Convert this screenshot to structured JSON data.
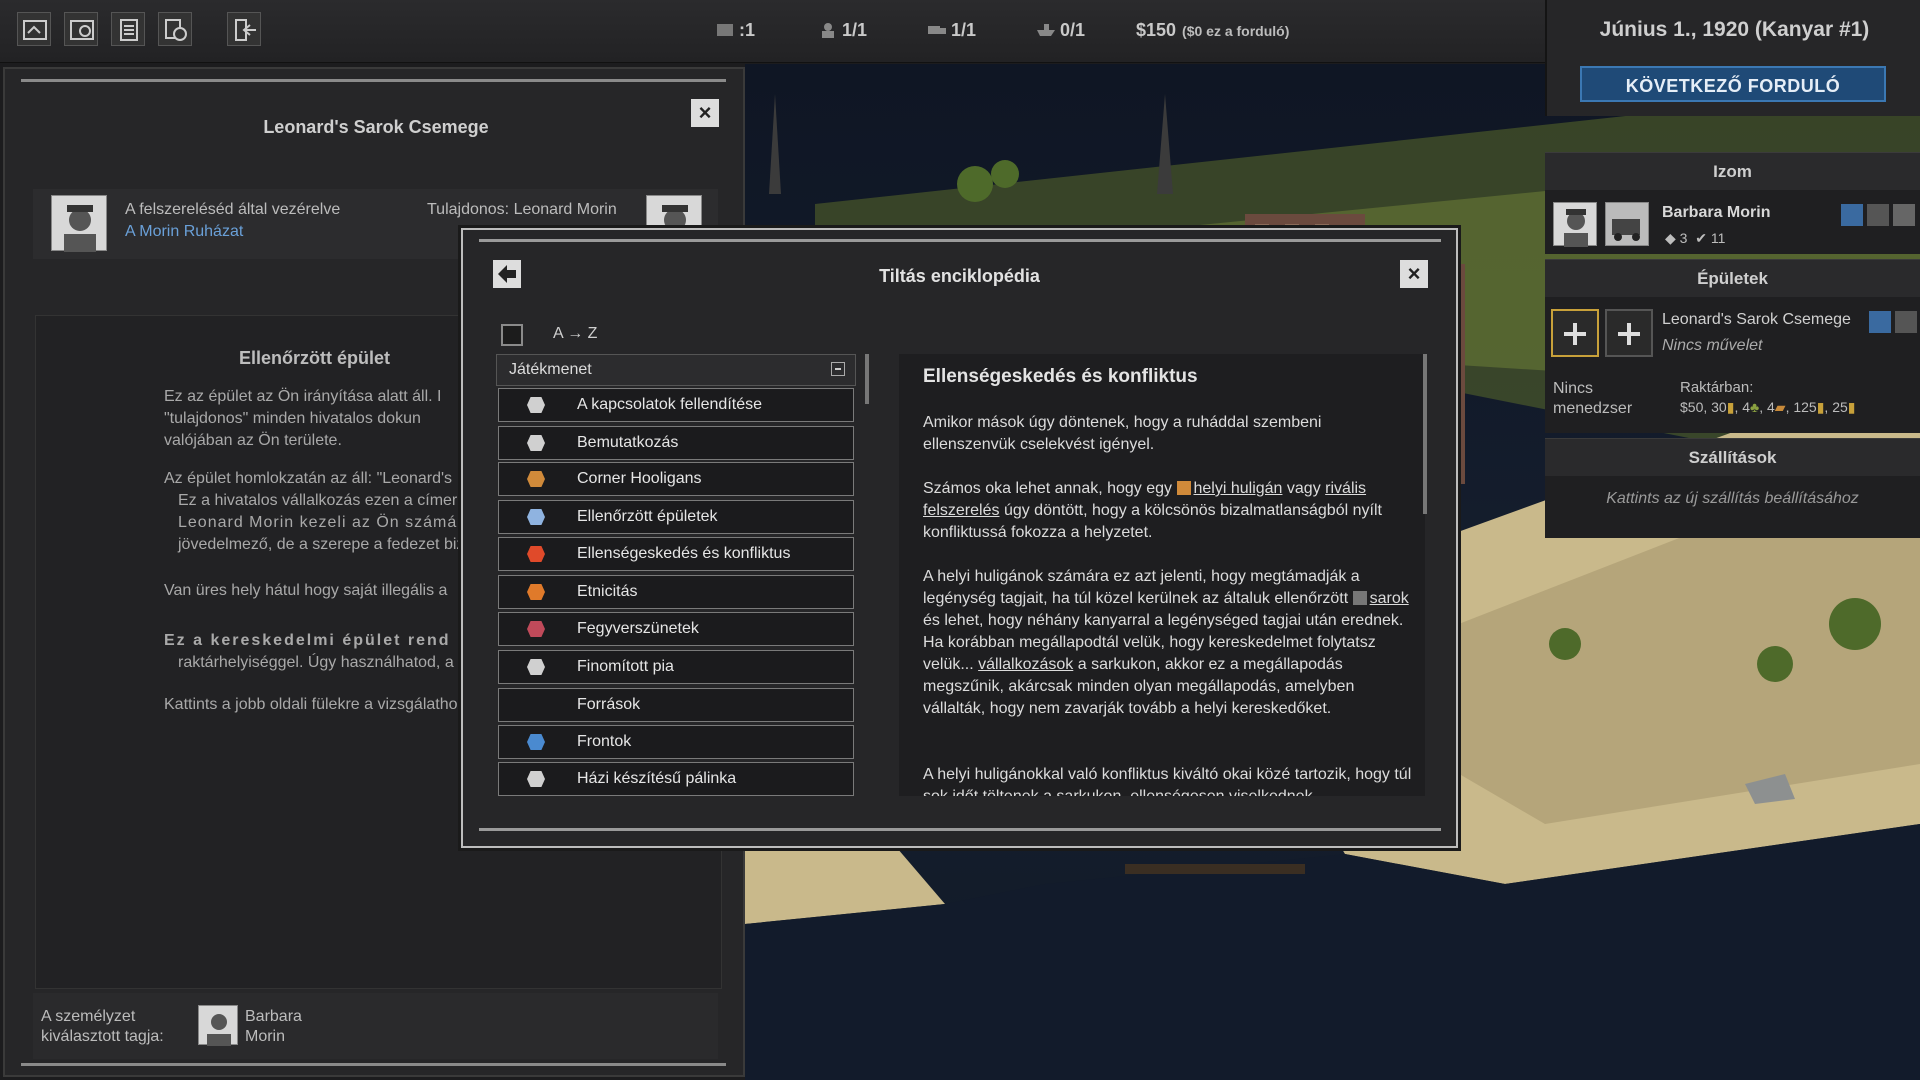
{
  "topbar": {
    "stat_corners": ":1",
    "stat_muscle": "1/1",
    "stat_trucks": "1/1",
    "stat_boats": "0/1",
    "money": "$150",
    "money_turn": "($0 ez a forduló)",
    "icons": [
      "map-icon",
      "map-search-icon",
      "notes-icon",
      "globe-icon",
      "exit-icon"
    ]
  },
  "right_panel": {
    "date": "Június 1., 1920  (Kanyar #1)",
    "next_turn": "KÖVETKEZŐ FORDULÓ",
    "muscle_title": "Izom",
    "muscle_name": "Barbara Morin",
    "muscle_stat1": "3",
    "muscle_stat2": "11",
    "buildings_title": "Épületek",
    "building_name": "Leonard's Sarok Csemege",
    "building_status": "Nincs művelet",
    "no_manager": "Nincs menedzser",
    "storage_label": "Raktárban:",
    "storage_values": "$50, 30",
    "storage_4a": "4",
    "storage_4b": "4",
    "storage_125": "125",
    "storage_25": "25",
    "shipments_title": "Szállítások",
    "shipments_hint": "Kattints az új szállítás beállításához"
  },
  "left_panel": {
    "title": "Leonard's Sarok Csemege",
    "controlled_by": "A felszereléséd által vezérelve",
    "controller_link": "A Morin Ruházat",
    "owner": "Tulajdonos: Leonard Morin",
    "section_title": "Ellenőrzött épület",
    "p1_a": "Ez az épület az Ön irányítása alatt áll. I",
    "p1_b": "\"tulajdonos\" minden hivatalos dokun",
    "p1_c": "valójában az Ön területe.",
    "b1_a": "Az épület homlokzatán az áll: \"Leonard's",
    "b1_b": "Ez a hivatalos vállalkozás ezen a címer",
    "b1_c": "Leonard Morin kezeli az Ön számá",
    "b1_d": "jövedelmező, de a szerepe a fedezet biz",
    "b2": "Van üres hely hátul hogy saját illegális a",
    "b3_a": "Ez a kereskedelmi épület rend",
    "b3_b": "raktárhelyiséggel. Úgy használhatod, a",
    "hint": "Kattints a jobb oldali fülekre a vizsgálatho",
    "crew_label": "A személyzet kiválasztott tagja:",
    "crew_name": "Barbara Morin"
  },
  "modal": {
    "title": "Tiltás enciklopédia",
    "sort_label": "A → Z",
    "category": "Játékmenet",
    "items": [
      {
        "label": "A kapcsolatok fellendítése",
        "icon": "handshake-icon",
        "color": "#d0d0d0"
      },
      {
        "label": "Bemutatkozás",
        "icon": "people-icon",
        "color": "#d0d0d0"
      },
      {
        "label": "Corner Hooligans",
        "icon": "hooligan-icon",
        "color": "#d08a3a"
      },
      {
        "label": "Ellenőrzött épületek",
        "icon": "building-icon",
        "color": "#8fb3e0"
      },
      {
        "label": "Ellenségeskedés és konfliktus",
        "icon": "lightning-icon",
        "color": "#e04a2a"
      },
      {
        "label": "Etnicitás",
        "icon": "flag-icon",
        "color": "#e07a2a"
      },
      {
        "label": "Fegyverszünetek",
        "icon": "truce-icon",
        "color": "#c04a5a"
      },
      {
        "label": "Finomított pia",
        "icon": "still-icon",
        "color": "#d0d0d0"
      },
      {
        "label": "Források",
        "icon": "",
        "color": "#d0d0d0"
      },
      {
        "label": "Frontok",
        "icon": "front-icon",
        "color": "#4a8ad0"
      },
      {
        "label": "Házi készítésű pálinka",
        "icon": "bottle-icon",
        "color": "#d0d0d0"
      }
    ],
    "content_title": "Ellenségeskedés és konfliktus",
    "p1": "Amikor mások úgy döntenek, hogy a ruháddal szembeni ellenszenvük cselekvést igényel.",
    "p2_a": "Számos oka lehet annak, hogy egy",
    "p2_link1": "helyi huligán",
    "p2_b": "vagy",
    "p2_link2a": "rivális",
    "p2_link2b": "felszerelés",
    "p2_c": "úgy döntött, hogy a kölcsönös bizalmatlanságból nyílt konfliktussá fokozza a helyzetet.",
    "p3_a": "A helyi huligánok számára ez azt jelenti, hogy megtámadják a legénység tagjait, ha túl közel kerülnek az általuk ellenőrzött",
    "p3_link1": "sarok",
    "p3_b": "és lehet, hogy néhány kanyarral a legénységed tagjai után erednek. Ha korábban megállapodtál velük, hogy kereskedelmet folytatsz velük...",
    "p3_link2": "vállalkozások",
    "p3_c": "a sarkukon, akkor ez a megállapodás megszűnik, akárcsak minden olyan megállapodás, amelyben vállalták, hogy nem zavarják tovább a helyi kereskedőket.",
    "p4": "A helyi huligánokkal való konfliktus kiváltó okai közé tartozik, hogy túl sok időt töltenek a sarkukon, ellenségesen viselkednek"
  }
}
